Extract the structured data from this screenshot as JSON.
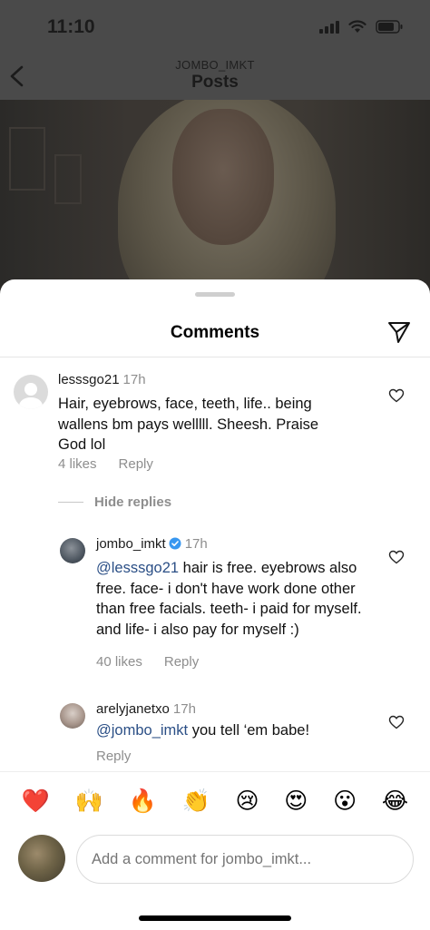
{
  "status_bar": {
    "time": "11:10"
  },
  "nav": {
    "subtitle": "JOMBO_IMKT",
    "title": "Posts"
  },
  "sheet": {
    "title": "Comments"
  },
  "comments": [
    {
      "username": "lesssgo21",
      "time": "17h",
      "text": "Hair, eyebrows, face, teeth, life.. being wallens bm pays welllll. Sheesh. Praise God lol",
      "likes": "4 likes",
      "reply": "Reply"
    }
  ],
  "hide_replies": "Hide replies",
  "replies": [
    {
      "username": "jombo_imkt",
      "verified": true,
      "time": "17h",
      "mention": "@lesssgo21",
      "text": " hair is free. eyebrows also free. face- i don't have work done other than free facials. teeth- i paid for myself. and life- i also pay for myself :)",
      "likes": "40 likes",
      "reply": "Reply"
    },
    {
      "username": "arelyjanetxo",
      "time": "17h",
      "mention": "@jombo_imkt",
      "text": " you tell ‘em babe!",
      "reply": "Reply"
    }
  ],
  "emoji_reactions": [
    "❤️",
    "🙌",
    "🔥",
    "👏",
    "😢",
    "😍",
    "😮",
    "😂"
  ],
  "input": {
    "placeholder": "Add a comment for jombo_imkt..."
  },
  "colors": {
    "mention": "#2b4f86",
    "verified": "#3897f0",
    "meta": "#8e8e8e"
  }
}
